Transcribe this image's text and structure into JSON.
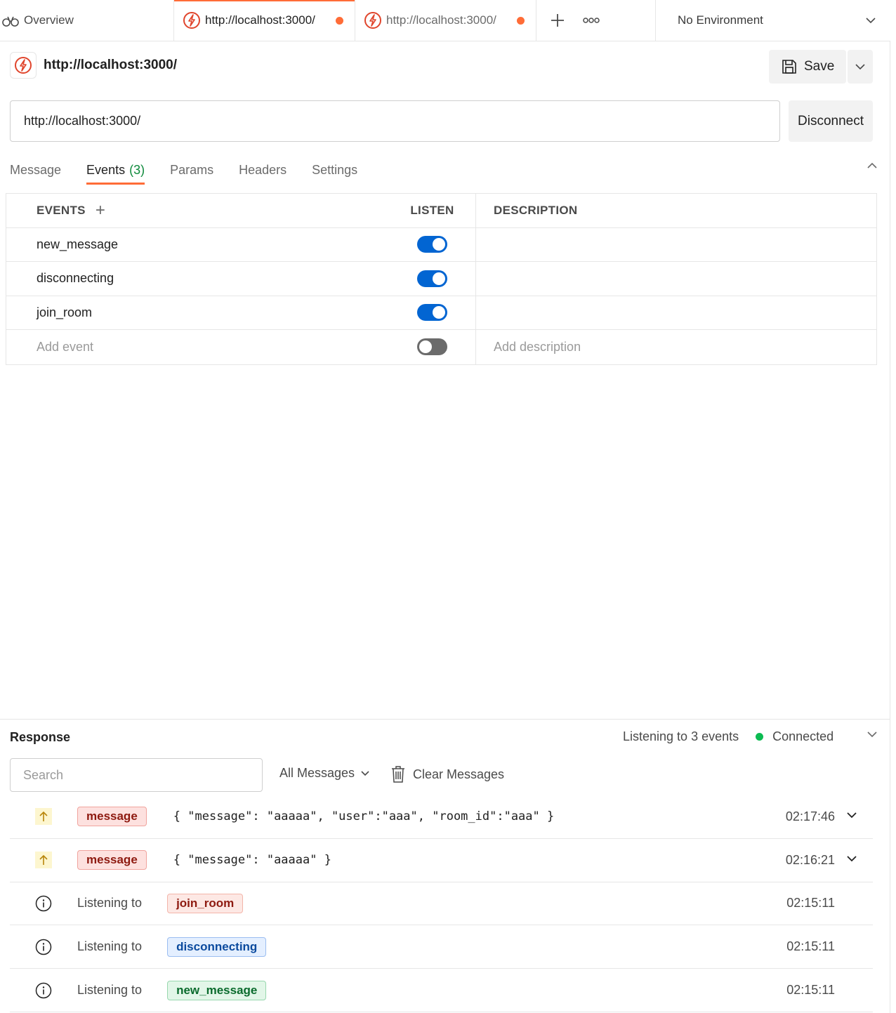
{
  "tabs": {
    "overview": "Overview",
    "tab1": "http://localhost:3000/",
    "tab2": "http://localhost:3000/",
    "environment": "No Environment"
  },
  "request": {
    "title": "http://localhost:3000/",
    "save_label": "Save",
    "url_value": "http://localhost:3000/",
    "disconnect_label": "Disconnect",
    "subtabs": {
      "message": "Message",
      "events": "Events",
      "events_count": "(3)",
      "params": "Params",
      "headers": "Headers",
      "settings": "Settings"
    }
  },
  "events_table": {
    "headers": {
      "events": "EVENTS",
      "listen": "LISTEN",
      "description": "DESCRIPTION"
    },
    "rows": [
      {
        "name": "new_message",
        "listen": true,
        "description": ""
      },
      {
        "name": "disconnecting",
        "listen": true,
        "description": ""
      },
      {
        "name": "join_room",
        "listen": true,
        "description": ""
      }
    ],
    "add_event_placeholder": "Add event",
    "add_description_placeholder": "Add description"
  },
  "response": {
    "title": "Response",
    "listening_text": "Listening to 3 events",
    "status": "Connected",
    "search_placeholder": "Search",
    "filter_label": "All Messages",
    "clear_label": "Clear Messages",
    "messages": [
      {
        "kind": "sent",
        "badge": "message",
        "body": "{ \"message\": \"aaaaa\", \"user\":\"aaa\", \"room_id\":\"aaa\" }",
        "time": "02:17:46"
      },
      {
        "kind": "sent",
        "badge": "message",
        "body": "{ \"message\": \"aaaaa\" }",
        "time": "02:16:21"
      },
      {
        "kind": "info",
        "text": "Listening to",
        "badge": "join_room",
        "time": "02:15:11"
      },
      {
        "kind": "info",
        "text": "Listening to",
        "badge": "disconnecting",
        "time": "02:15:11"
      },
      {
        "kind": "info",
        "text": "Listening to",
        "badge": "new_message",
        "time": "02:15:11"
      }
    ]
  },
  "colors": {
    "accent": "#ff6c37",
    "toggle_on": "#0265d2",
    "connected": "#0cbb52"
  }
}
